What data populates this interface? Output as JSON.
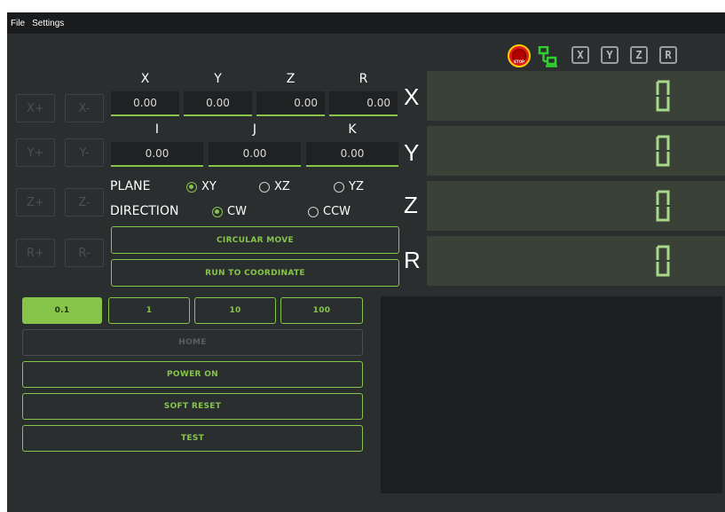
{
  "menu": {
    "file": "File",
    "settings": "Settings"
  },
  "status": {
    "estop_label": "STOP",
    "axis_badges": [
      "X",
      "Y",
      "Z",
      "R"
    ]
  },
  "jog": {
    "x_plus": "X+",
    "x_minus": "X-",
    "y_plus": "Y+",
    "y_minus": "Y-",
    "z_plus": "Z+",
    "z_minus": "Z-",
    "r_plus": "R+",
    "r_minus": "R-"
  },
  "coords": {
    "labels": [
      "X",
      "Y",
      "Z",
      "R"
    ],
    "values": [
      "0.00",
      "0.00",
      "0.00",
      "0.00"
    ]
  },
  "arc": {
    "labels": [
      "I",
      "J",
      "K"
    ],
    "values": [
      "0.00",
      "0.00",
      "0.00"
    ]
  },
  "plane": {
    "label": "PLANE",
    "options": [
      "XY",
      "XZ",
      "YZ"
    ],
    "selected": "XY"
  },
  "direction": {
    "label": "DIRECTION",
    "options": [
      "CW",
      "CCW"
    ],
    "selected": "CW"
  },
  "actions": {
    "circular_move": "CIRCULAR MOVE",
    "run_to_coordinate": "RUN TO COORDINATE"
  },
  "steps": {
    "options": [
      "0.1",
      "1",
      "10",
      "100"
    ],
    "selected": "0.1"
  },
  "controls": {
    "home": "HOME",
    "power_on": "POWER ON",
    "soft_reset": "SOFT RESET",
    "test": "TEST"
  },
  "dro": {
    "axes": [
      "X",
      "Y",
      "Z",
      "R"
    ],
    "values": [
      "0",
      "0",
      "0",
      "0"
    ]
  },
  "colors": {
    "accent": "#86c44a",
    "background": "#2b2e2f",
    "menubar": "#1a1b1c",
    "dro_panel": "#3a4237"
  }
}
